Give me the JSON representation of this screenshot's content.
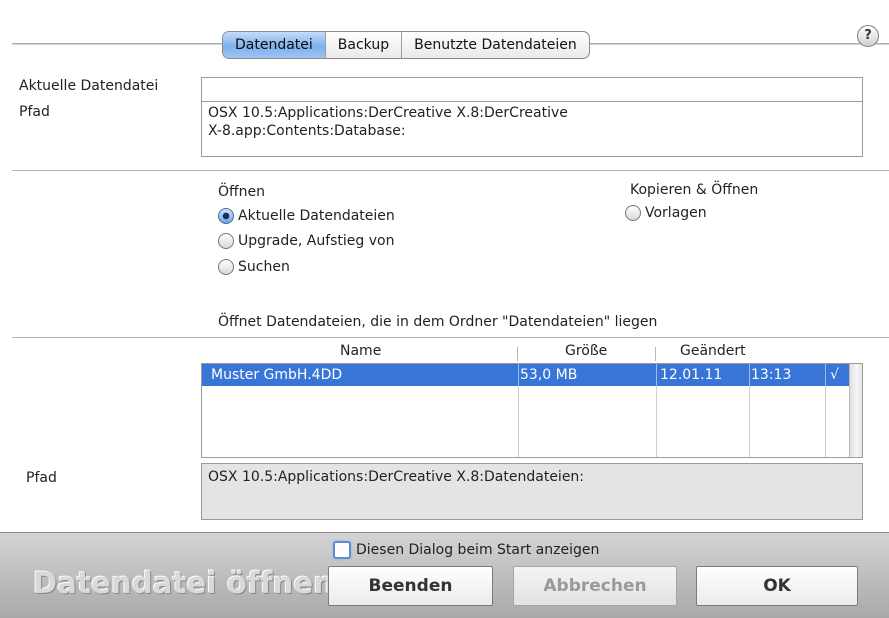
{
  "tabs": [
    "Datendatei",
    "Backup",
    "Benutzte Datendateien"
  ],
  "help_label": "?",
  "current": {
    "label": "Aktuelle Datendatei",
    "value": "",
    "path_label": "Pfad",
    "path_line1": "OSX 10.5:Applications:DerCreative X.8:DerCreative",
    "path_line2": "X-8.app:Contents:Database:"
  },
  "open_group": {
    "title": "Öffnen",
    "options": [
      "Aktuelle Datendateien",
      "Upgrade, Aufstieg von",
      "Suchen"
    ],
    "selected": 0
  },
  "copy_group": {
    "title": "Kopieren & Öffnen",
    "options": [
      "Vorlagen"
    ]
  },
  "description": "Öffnet Datendateien, die in dem Ordner \"Datendateien\" liegen",
  "files": {
    "headers": [
      "Name",
      "Größe",
      "Geändert"
    ],
    "rows": [
      {
        "name": "Muster GmbH.4DD",
        "size": "53,0 MB",
        "date": "12.01.11",
        "time": "13:13",
        "check": "√"
      }
    ]
  },
  "bottom_path": {
    "label": "Pfad",
    "value": "OSX 10.5:Applications:DerCreative X.8:Datendateien:"
  },
  "footer": {
    "checkbox_label": "Diesen Dialog beim Start anzeigen",
    "title": "Datendatei öffnen",
    "buttons": {
      "quit": "Beenden",
      "cancel": "Abbrechen",
      "ok": "OK"
    }
  },
  "colors": {
    "selection": "#3875d7",
    "tab_active": "#7fb1ec"
  }
}
